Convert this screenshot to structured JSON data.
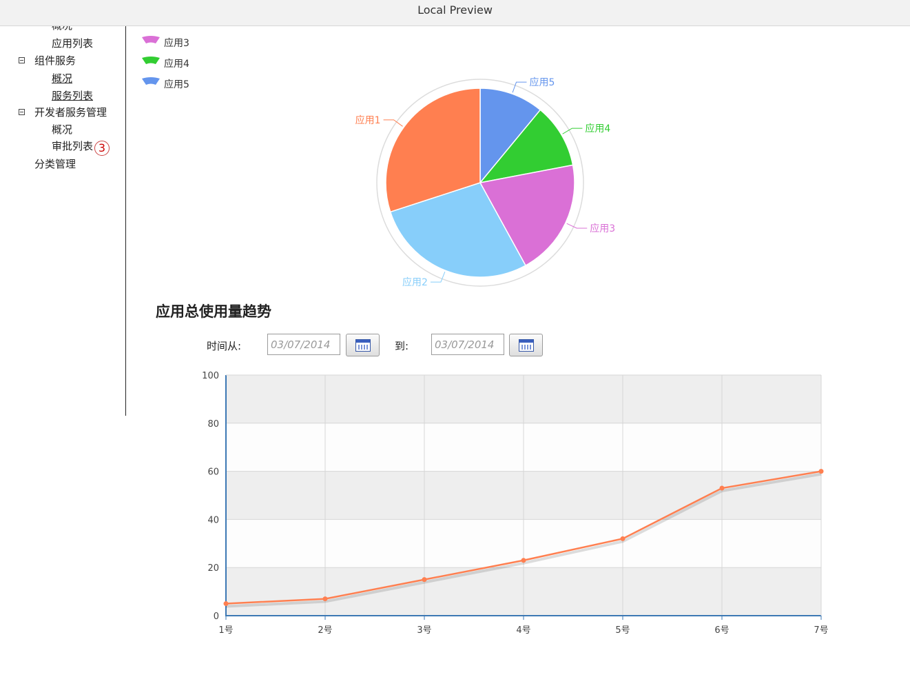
{
  "window": {
    "title": "Local Preview"
  },
  "sidebar": {
    "items": [
      {
        "label": "概况"
      },
      {
        "label": "应用列表"
      },
      {
        "label": "组件服务"
      },
      {
        "label": "概况"
      },
      {
        "label": "服务列表"
      },
      {
        "label": "开发者服务管理"
      },
      {
        "label": "概况"
      },
      {
        "label": "审批列表",
        "badge": "3"
      },
      {
        "label": "分类管理"
      }
    ]
  },
  "chart_data": [
    {
      "type": "pie",
      "categories": [
        "应用5",
        "应用4",
        "应用3",
        "应用2",
        "应用1"
      ],
      "values": [
        11,
        11,
        20,
        28,
        30
      ],
      "colors": [
        "#6495ed",
        "#32cd32",
        "#da70d6",
        "#87cefa",
        "#ff7f50"
      ],
      "legend": [
        "应用3",
        "应用4",
        "应用5"
      ],
      "legend_position": "top-left"
    },
    {
      "type": "line",
      "title": "应用总使用量趋势",
      "categories": [
        "1号",
        "2号",
        "3号",
        "4号",
        "5号",
        "6号",
        "7号"
      ],
      "series": [
        {
          "values": [
            5,
            7,
            15,
            23,
            32,
            53,
            60
          ],
          "color": "#ff7f50"
        }
      ],
      "y_ticks": [
        "0",
        "20",
        "40",
        "60",
        "80",
        "100"
      ],
      "ylim": [
        0,
        100
      ],
      "grid": true
    }
  ],
  "filter": {
    "from_label": "时间从:",
    "to_label": "到:",
    "from_placeholder": "03/07/2014",
    "to_placeholder": "03/07/2014"
  }
}
